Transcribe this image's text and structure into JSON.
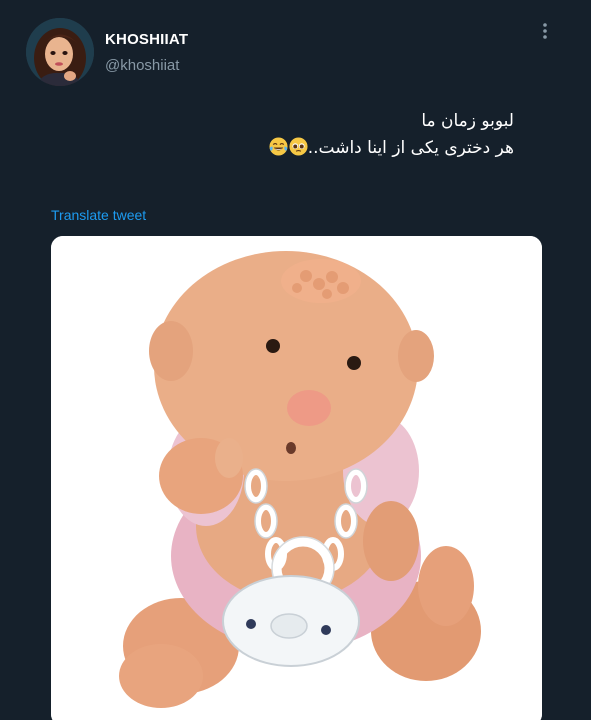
{
  "author": {
    "display_name": "KHOSHIIAT",
    "handle": "@khoshiiat",
    "avatar_icon": "avatar-icon"
  },
  "menu": {
    "more_icon": "more-vertical-icon"
  },
  "tweet": {
    "line1": "لبوبو زمان ما",
    "line2": "هر دختری یکی از اینا داشت..",
    "emojis": [
      "pleading-face-emoji",
      "tears-of-joy-emoji"
    ]
  },
  "translate_label": "Translate tweet",
  "media": {
    "subject_icon": "baby-doll-with-pacifier"
  },
  "colors": {
    "background": "#15202b",
    "secondary_text": "#8899a6",
    "link": "#1d9bf0"
  }
}
